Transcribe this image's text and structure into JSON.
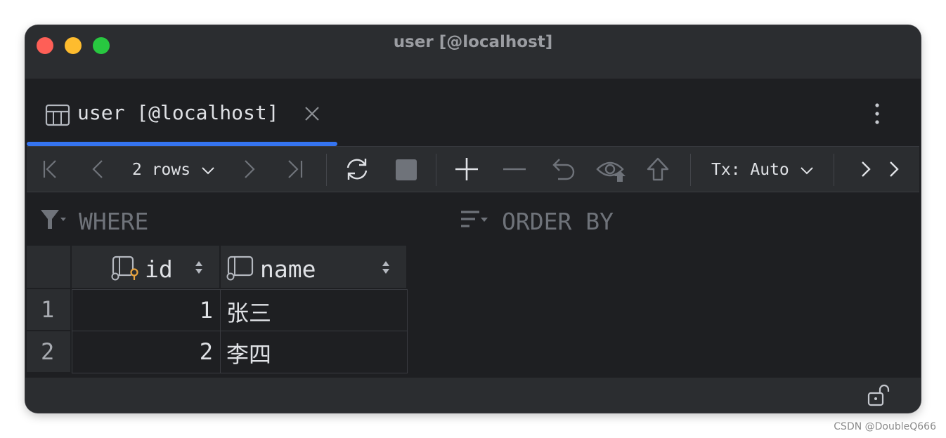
{
  "window": {
    "title": "user [@localhost]"
  },
  "tab": {
    "label": "user [@localhost]"
  },
  "toolbar": {
    "rows_label": "2 rows",
    "tx_label": "Tx: Auto"
  },
  "filters": {
    "where_label": "WHERE",
    "order_by_label": "ORDER BY"
  },
  "table": {
    "columns": [
      {
        "label": "id",
        "icon": "primary-key-column-icon"
      },
      {
        "label": "name",
        "icon": "column-icon"
      }
    ],
    "rows": [
      {
        "num": "1",
        "id": "1",
        "name": "张三"
      },
      {
        "num": "2",
        "id": "2",
        "name": "李四"
      }
    ]
  },
  "colors": {
    "accent": "#3574f0",
    "background": "#1e1f22",
    "panel": "#2b2d30"
  },
  "watermark": "CSDN @DoubleQ666"
}
